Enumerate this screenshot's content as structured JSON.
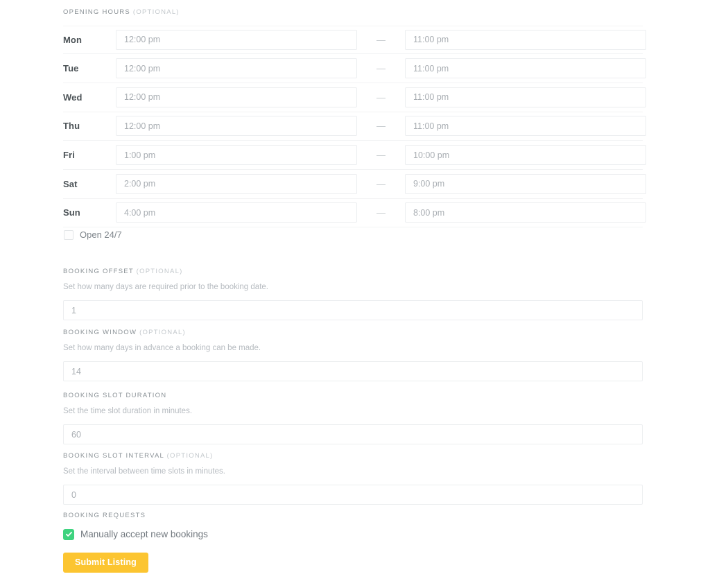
{
  "opening_hours": {
    "label": "OPENING HOURS",
    "optional_suffix": "(OPTIONAL)",
    "separator": "—",
    "rows": [
      {
        "day": "Mon",
        "open": "12:00 pm",
        "close": "11:00 pm"
      },
      {
        "day": "Tue",
        "open": "12:00 pm",
        "close": "11:00 pm"
      },
      {
        "day": "Wed",
        "open": "12:00 pm",
        "close": "11:00 pm"
      },
      {
        "day": "Thu",
        "open": "12:00 pm",
        "close": "11:00 pm"
      },
      {
        "day": "Fri",
        "open": "1:00 pm",
        "close": "10:00 pm"
      },
      {
        "day": "Sat",
        "open": "2:00 pm",
        "close": "9:00 pm"
      },
      {
        "day": "Sun",
        "open": "4:00 pm",
        "close": "8:00 pm"
      }
    ],
    "open_247": {
      "label": "Open 24/7",
      "checked": false
    }
  },
  "booking_offset": {
    "label": "BOOKING OFFSET",
    "optional_suffix": "(OPTIONAL)",
    "help": "Set how many days are required prior to the booking date.",
    "value": "1"
  },
  "booking_window": {
    "label": "BOOKING WINDOW",
    "optional_suffix": "(OPTIONAL)",
    "help": "Set how many days in advance a booking can be made.",
    "value": "14"
  },
  "booking_slot_duration": {
    "label": "BOOKING SLOT DURATION",
    "optional_suffix": "",
    "help": "Set the time slot duration in minutes.",
    "value": "60"
  },
  "booking_slot_interval": {
    "label": "BOOKING SLOT INTERVAL",
    "optional_suffix": "(OPTIONAL)",
    "help": "Set the interval between time slots in minutes.",
    "value": "0"
  },
  "booking_requests": {
    "label": "BOOKING REQUESTS",
    "manual_accept_label": "Manually accept new bookings",
    "manual_accept_checked": true
  },
  "submit": {
    "label": "Submit Listing"
  },
  "colors": {
    "accent_button": "#fcc531",
    "checkbox_checked": "#3ed37f",
    "label_text": "#8a9196",
    "help_text": "#b6bbc0",
    "input_border": "#eceef0",
    "row_divider": "#f2f3f4",
    "day_text": "#4c5357"
  }
}
